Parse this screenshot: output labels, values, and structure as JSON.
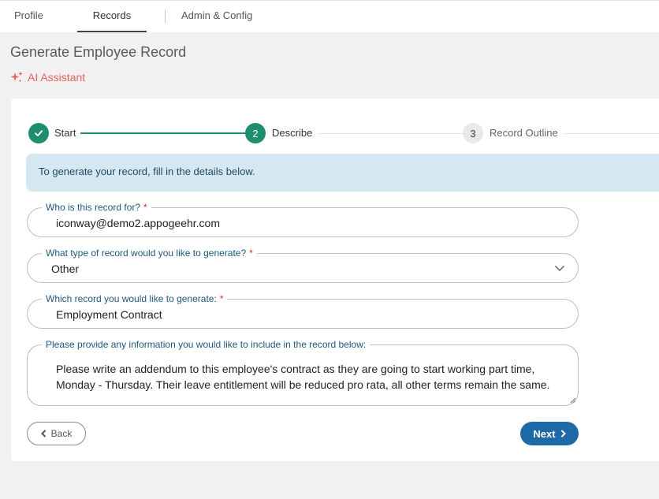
{
  "nav": {
    "tabs": [
      {
        "label": "Profile"
      },
      {
        "label": "Records"
      },
      {
        "label": "Admin & Config"
      }
    ],
    "active_tab": "Records"
  },
  "page": {
    "title": "Generate Employee Record",
    "ai_assistant_label": "AI Assistant",
    "ai_assistant_icon": "sparkle-icon"
  },
  "stepper": {
    "steps": [
      {
        "number": "1",
        "label": "Start",
        "state": "complete"
      },
      {
        "number": "2",
        "label": "Describe",
        "state": "active"
      },
      {
        "number": "3",
        "label": "Record Outline",
        "state": "pending"
      }
    ]
  },
  "banner": {
    "text": "To generate your record, fill in the details below."
  },
  "form": {
    "recipient": {
      "label": "Who is this record for?",
      "required_mark": "*",
      "value": "iconway@demo2.appogeehr.com"
    },
    "record_type": {
      "label": "What type of record would you like to generate?",
      "required_mark": "*",
      "value": "Other"
    },
    "record_name": {
      "label": "Which record you would like to generate:",
      "required_mark": "*",
      "value": "Employment Contract"
    },
    "details": {
      "label": "Please provide any information you would like to include in the record below:",
      "value": "Please write an addendum to this employee's contract as they are going to start working part time, Monday - Thursday. Their leave entitlement will be reduced pro rata, all other terms remain the same."
    }
  },
  "actions": {
    "back_label": "Back",
    "next_label": "Next"
  },
  "colors": {
    "accent_green": "#1d8f6e",
    "primary_blue": "#1e6aa8",
    "ai_coral": "#e8635a",
    "banner_bg": "#d5e8f1",
    "label_blue": "#1a5a85",
    "required_red": "#d42b2b"
  }
}
